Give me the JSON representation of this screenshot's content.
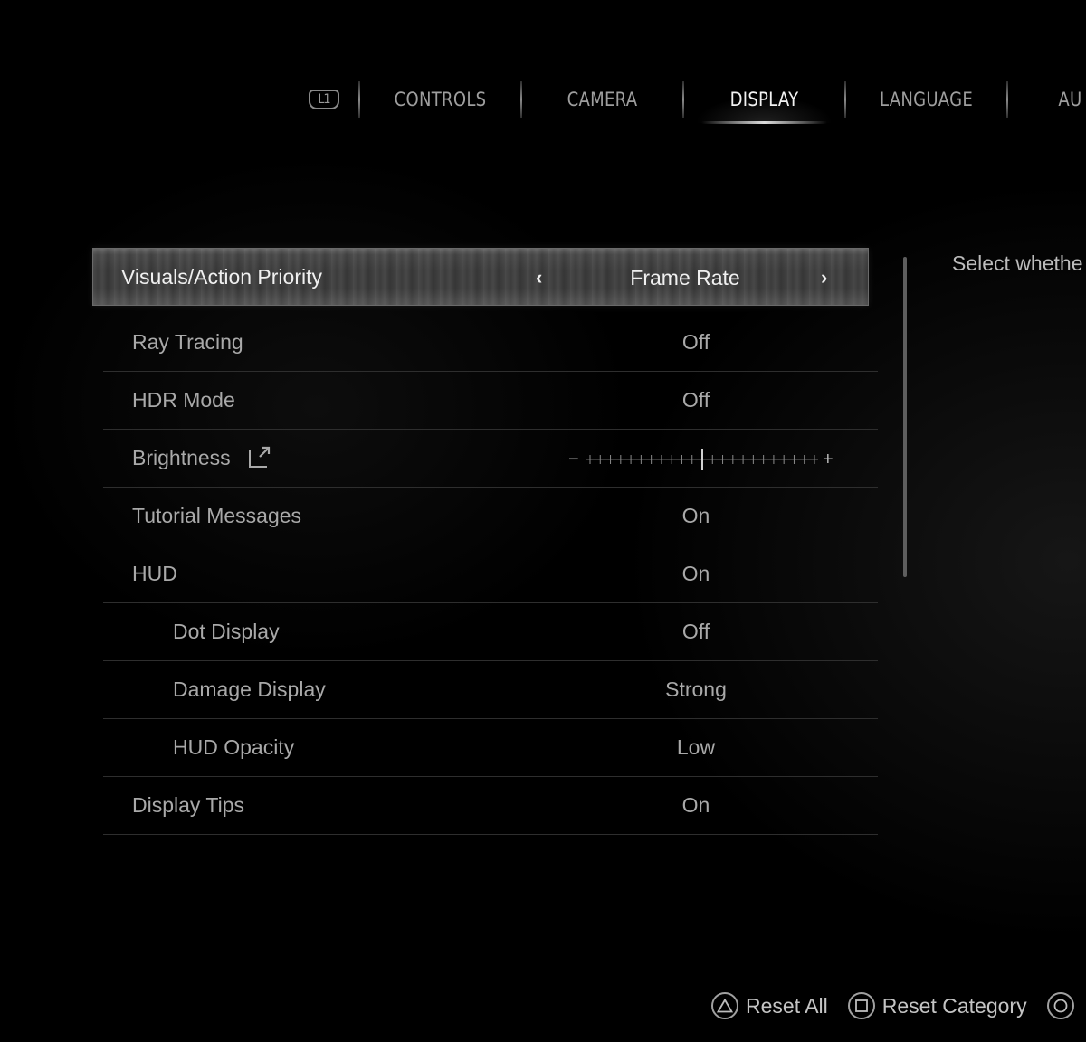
{
  "tabs": {
    "left_bumper": "L1",
    "items": [
      {
        "label": "CONTROLS",
        "active": false
      },
      {
        "label": "CAMERA",
        "active": false
      },
      {
        "label": "DISPLAY",
        "active": true
      },
      {
        "label": "LANGUAGE",
        "active": false
      },
      {
        "label": "AU",
        "active": false
      }
    ]
  },
  "settings": {
    "selected": {
      "label": "Visuals/Action Priority",
      "value": "Frame Rate",
      "prev_arrow": "‹",
      "next_arrow": "›"
    },
    "rows": [
      {
        "label": "Ray Tracing",
        "value": "Off"
      },
      {
        "label": "HDR Mode",
        "value": "Off"
      },
      {
        "label": "Brightness",
        "slider_level": 0.5,
        "slider_minus": "−",
        "slider_plus": "+"
      },
      {
        "label": "Tutorial Messages",
        "value": "On"
      },
      {
        "label": "HUD",
        "value": "On"
      },
      {
        "label": "Dot Display",
        "value": "Off"
      },
      {
        "label": "Damage Display",
        "value": "Strong"
      },
      {
        "label": "HUD Opacity",
        "value": "Low"
      },
      {
        "label": "Display Tips",
        "value": "On"
      }
    ]
  },
  "description": "Select whethe",
  "footer": {
    "reset_all": "Reset All",
    "reset_category": "Reset Category"
  },
  "icons": {
    "l1": "l1-button-icon",
    "triangle": "triangle-button-icon",
    "square": "square-button-icon",
    "circle": "circle-button-icon",
    "external": "external-link-icon"
  }
}
